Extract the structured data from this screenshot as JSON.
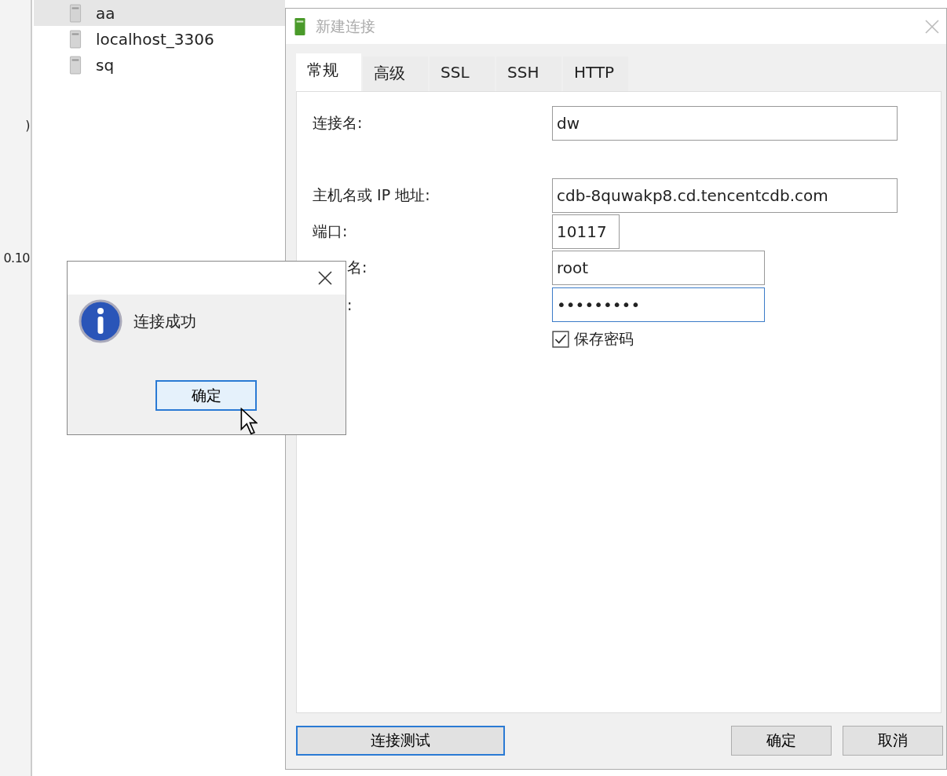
{
  "side_fragments": [
    ")",
    "0.10"
  ],
  "connections": [
    {
      "name": "aa",
      "selected": true
    },
    {
      "name": "localhost_3306",
      "selected": false
    },
    {
      "name": "sq",
      "selected": false
    }
  ],
  "dialog": {
    "title": "新建连接",
    "tabs": [
      {
        "label": "常规",
        "selected": true
      },
      {
        "label": "高级",
        "selected": false
      },
      {
        "label": "SSL",
        "selected": false
      },
      {
        "label": "SSH",
        "selected": false
      },
      {
        "label": "HTTP",
        "selected": false
      }
    ],
    "fields": [
      {
        "label": "连接名:",
        "value": "dw",
        "kind": "wide",
        "covered": false,
        "focused": false
      },
      {
        "label": "主机名或 IP 地址:",
        "value": "cdb-8quwakp8.cd.tencentcdb.com",
        "kind": "wide",
        "covered": false,
        "focused": false
      },
      {
        "label": "端口:",
        "value": "10117",
        "kind": "short",
        "covered": false,
        "focused": false
      },
      {
        "label": "名:",
        "value": "root",
        "kind": "medium",
        "covered": true,
        "focused": false
      },
      {
        "label": ":",
        "value": "•••••••••",
        "kind": "medium",
        "covered": true,
        "focused": true
      }
    ],
    "save_password": {
      "label": "保存密码",
      "checked": true
    },
    "test_button": "连接测试",
    "ok_button": "确定",
    "cancel_button": "取消"
  },
  "message": {
    "text": "连接成功",
    "ok_button": "确定"
  }
}
